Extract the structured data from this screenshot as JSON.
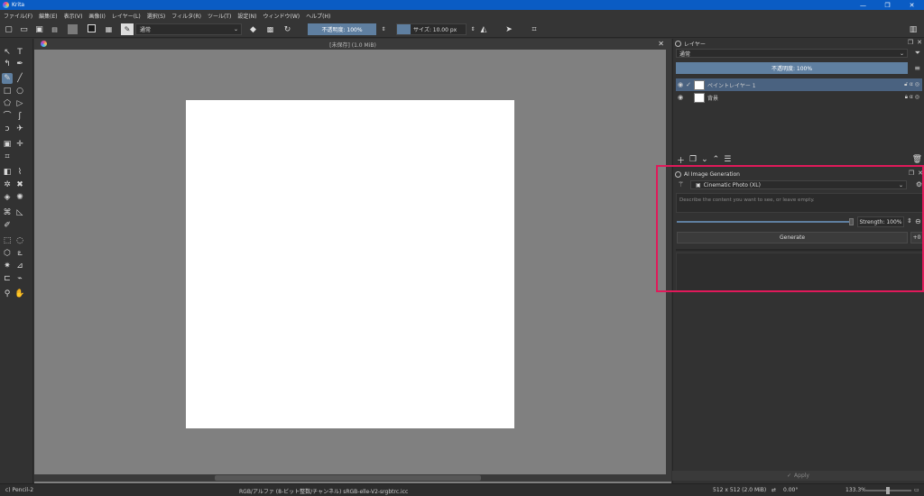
{
  "window": {
    "title": "Krita",
    "controls": [
      "—",
      "❐",
      "✕"
    ]
  },
  "menu": [
    "ファイル(F)",
    "編集(E)",
    "表示(V)",
    "画像(I)",
    "レイヤー(L)",
    "選択(S)",
    "フィルタ(R)",
    "ツール(T)",
    "設定(N)",
    "ウィンドウ(W)",
    "ヘルプ(H)"
  ],
  "toolbar": {
    "blend_mode": "通常",
    "opacity": "不透明度: 100%",
    "size": "サイズ: 10.00 px",
    "fg_color": "#1a1a1a",
    "bg_color": "#7a7a7a"
  },
  "document": {
    "tab_title": "[未保存] (1.0 MiB)",
    "close": "✕"
  },
  "layers_panel": {
    "title": "レイヤー",
    "blend_mode": "通常",
    "opacity": "不透明度: 100%",
    "layers": [
      {
        "name": "ペイントレイヤー 1",
        "selected": true
      },
      {
        "name": "背景",
        "selected": false
      }
    ]
  },
  "ai_panel": {
    "title": "AI Image Generation",
    "model": "Cinematic Photo (XL)",
    "prompt_placeholder": "Describe the content you want to see, or leave empty.",
    "strength": "Strength: 100%",
    "strength_value": 1.0,
    "generate": "Generate",
    "plus": "+0"
  },
  "apply_label": "Apply",
  "status": {
    "brush": "c) Pencil-2",
    "color_model": "RGB/アルファ (8-ビット整数/チャンネル)  sRGB-elle-V2-srgbtrc.icc",
    "dimensions": "512 x 512 (2.0 MiB)",
    "rotation": "0.00°",
    "zoom": "133.3%"
  },
  "accent_color": "#5f7fa0",
  "highlight_color": "#e0195a"
}
